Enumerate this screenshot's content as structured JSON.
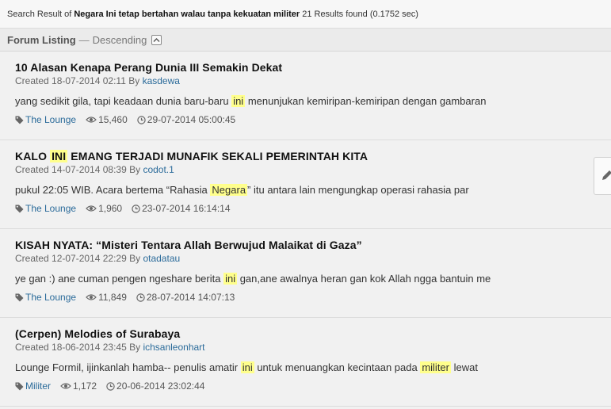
{
  "search": {
    "prefix": "Search Result of",
    "query": "Negara Ini tetap bertahan walau tanpa kekuatan militer",
    "summary": "21 Results found (0.1752 sec)"
  },
  "listing": {
    "label": "Forum Listing",
    "separator": "—",
    "order": "Descending"
  },
  "threads": [
    {
      "title_parts": [
        {
          "t": "10 Alasan Kenapa Perang Dunia III Semakin Dekat",
          "h": false
        }
      ],
      "created": "Created 18-07-2014 02:11 By",
      "author": "kasdewa",
      "snippet_parts": [
        {
          "t": "yang sedikit gila, tapi keadaan dunia baru-baru ",
          "h": false
        },
        {
          "t": "ini",
          "h": true
        },
        {
          "t": " menunjukan kemiripan-kemiripan dengan gambaran",
          "h": false
        }
      ],
      "forum": "The Lounge",
      "views": "15,460",
      "last_post": "29-07-2014 05:00:45"
    },
    {
      "title_parts": [
        {
          "t": "KALO ",
          "h": false
        },
        {
          "t": "INI",
          "h": true
        },
        {
          "t": " EMANG TERJADI MUNAFIK SEKALI PEMERINTAH KITA",
          "h": false
        }
      ],
      "created": "Created 14-07-2014 08:39 By",
      "author": "codot.1",
      "snippet_parts": [
        {
          "t": "pukul 22:05 WIB. Acara bertema “Rahasia ",
          "h": false
        },
        {
          "t": "Negara",
          "h": true
        },
        {
          "t": "” itu antara lain mengungkap operasi rahasia par",
          "h": false
        }
      ],
      "forum": "The Lounge",
      "views": "1,960",
      "last_post": "23-07-2014 16:14:14"
    },
    {
      "title_parts": [
        {
          "t": "KISAH NYATA: “Misteri Tentara Allah Berwujud Malaikat di Gaza”",
          "h": false
        }
      ],
      "created": "Created 12-07-2014 22:29 By",
      "author": "otadatau",
      "snippet_parts": [
        {
          "t": "ye gan :) ane cuman pengen ngeshare berita ",
          "h": false
        },
        {
          "t": "ini",
          "h": true
        },
        {
          "t": " gan,ane awalnya heran gan kok Allah ngga bantuin me",
          "h": false
        }
      ],
      "forum": "The Lounge",
      "views": "11,849",
      "last_post": "28-07-2014 14:07:13"
    },
    {
      "title_parts": [
        {
          "t": "(Cerpen) Melodies of Surabaya",
          "h": false
        }
      ],
      "created": "Created 18-06-2014 23:45 By",
      "author": "ichsanleonhart",
      "snippet_parts": [
        {
          "t": "Lounge Formil, ijinkanlah hamba-- penulis amatir ",
          "h": false
        },
        {
          "t": "ini",
          "h": true
        },
        {
          "t": " untuk menuangkan kecintaan pada ",
          "h": false
        },
        {
          "t": "militer",
          "h": true
        },
        {
          "t": " lewat",
          "h": false
        }
      ],
      "forum": "Militer",
      "views": "1,172",
      "last_post": "20-06-2014 23:02:44"
    }
  ],
  "icons": {
    "forum": "tag-icon",
    "views": "eye-icon",
    "last_post": "clock-icon",
    "collapse": "chevron-up-icon",
    "side_tab": "pencil-icon"
  },
  "colors": {
    "link": "#2b6b9a",
    "highlight": "#ffff8c",
    "background": "#f1f1f1"
  }
}
